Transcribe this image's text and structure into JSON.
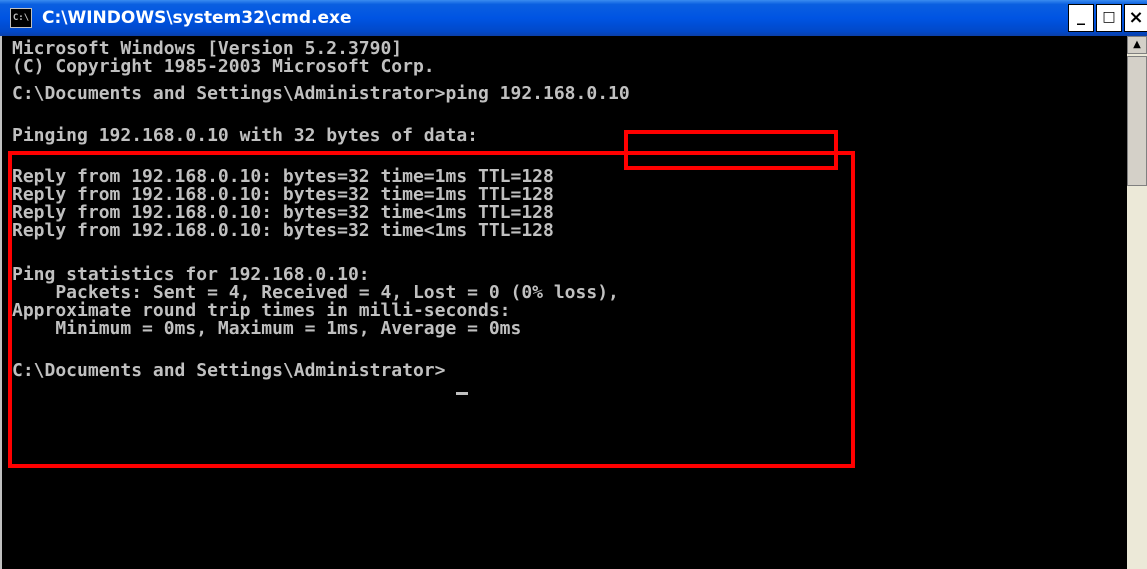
{
  "window": {
    "title": "C:\\WINDOWS\\system32\\cmd.exe",
    "icon": "cmd-icon",
    "icon_label": "C:\\",
    "minimize_label": "_",
    "maximize_label": "□",
    "close_label": "×"
  },
  "console": {
    "lines": [
      "Microsoft Windows [Version 5.2.3790]",
      "(C) Copyright 1985-2003 Microsoft Corp.",
      "",
      "C:\\Documents and Settings\\Administrator>ping 192.168.0.10",
      "",
      "Pinging 192.168.0.10 with 32 bytes of data:",
      "",
      "Reply from 192.168.0.10: bytes=32 time=1ms TTL=128",
      "Reply from 192.168.0.10: bytes=32 time=1ms TTL=128",
      "Reply from 192.168.0.10: bytes=32 time<1ms TTL=128",
      "Reply from 192.168.0.10: bytes=32 time<1ms TTL=128",
      "",
      "Ping statistics for 192.168.0.10:",
      "    Packets: Sent = 4, Received = 4, Lost = 0 (0% loss),",
      "Approximate round trip times in milli-seconds:",
      "    Minimum = 0ms, Maximum = 1ms, Average = 0ms",
      "",
      "C:\\Documents and Settings\\Administrator>"
    ]
  },
  "colors": {
    "console_bg": "#000000",
    "console_text": "#c0c0c0",
    "titlebar": "#0054e3",
    "highlight": "#ff0000"
  },
  "icons": {
    "scroll_up": "scroll-up-arrow-icon"
  }
}
